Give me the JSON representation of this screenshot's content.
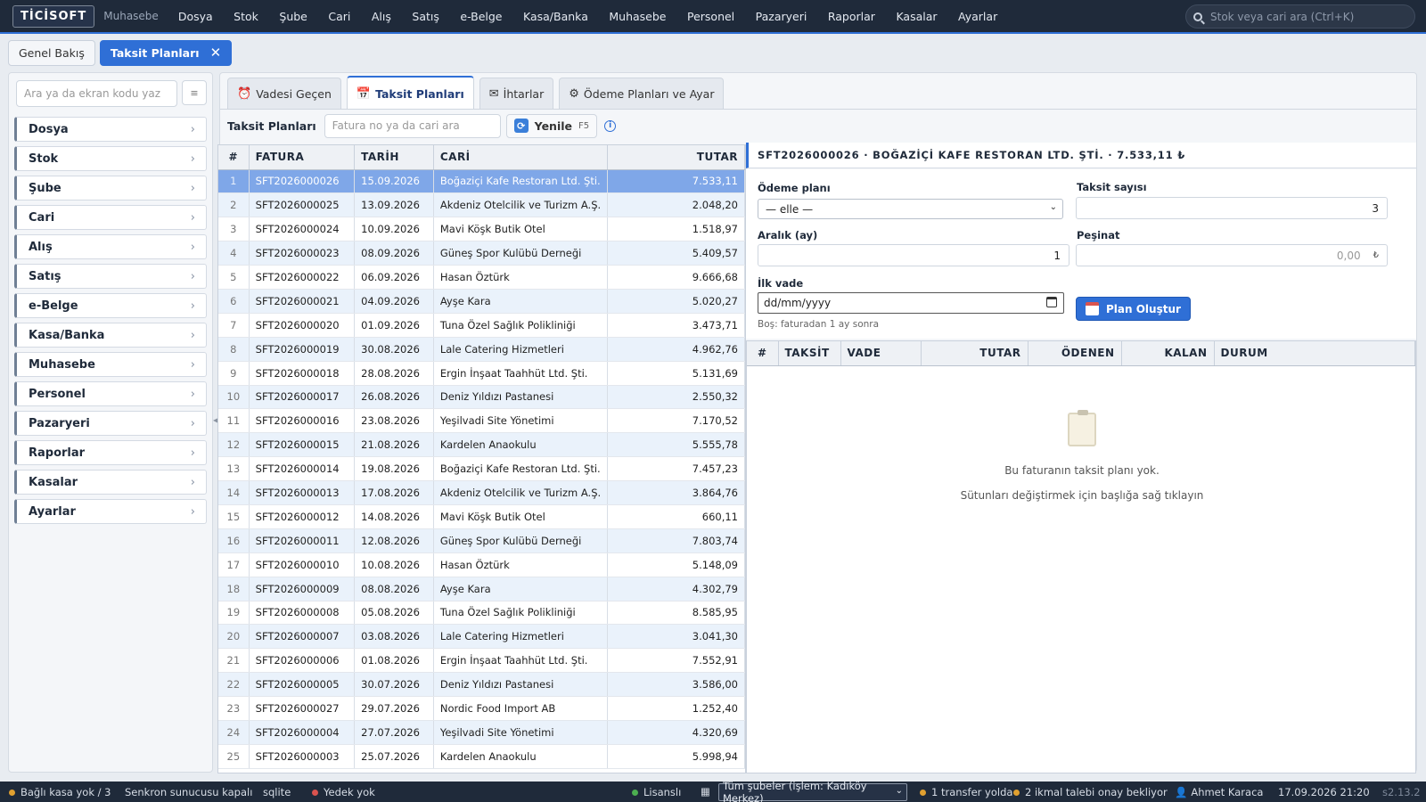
{
  "app": {
    "logo": "TİCİSOFT",
    "subtitle": "Muhasebe"
  },
  "top_menu": [
    "Dosya",
    "Stok",
    "Şube",
    "Cari",
    "Alış",
    "Satış",
    "e-Belge",
    "Kasa/Banka",
    "Muhasebe",
    "Personel",
    "Pazaryeri",
    "Raporlar",
    "Kasalar",
    "Ayarlar"
  ],
  "top_search": {
    "placeholder": "Stok veya cari ara (Ctrl+K)"
  },
  "page_tabs": [
    {
      "label": "Genel Bakış",
      "active": false
    },
    {
      "label": "Taksit Planları",
      "active": true,
      "close": "✕"
    }
  ],
  "sidebar": {
    "search_placeholder": "Ara ya da ekran kodu yaz",
    "button_icon": "≡",
    "items": [
      "Dosya",
      "Stok",
      "Şube",
      "Cari",
      "Alış",
      "Satış",
      "e-Belge",
      "Kasa/Banka",
      "Muhasebe",
      "Personel",
      "Pazaryeri",
      "Raporlar",
      "Kasalar",
      "Ayarlar"
    ],
    "chevron": "›"
  },
  "content_tabs": [
    {
      "label": "Vadesi Geçen",
      "icon": "⏰",
      "icon_name": "alarm-clock-icon"
    },
    {
      "label": "Taksit Planları",
      "icon": "📅",
      "icon_name": "calendar-icon"
    },
    {
      "label": "İhtarlar",
      "icon": "✉",
      "icon_name": "envelope-icon"
    },
    {
      "label": "Ödeme Planları ve Ayar",
      "icon": "⚙",
      "icon_name": "gear-icon"
    }
  ],
  "toolbar": {
    "label": "Taksit Planları",
    "search_placeholder": "Fatura no ya da cari ara",
    "refresh_label": "Yenile",
    "refresh_key": "F5",
    "info": "i"
  },
  "invoice_grid": {
    "columns": [
      "#",
      "FATURA",
      "TARİH",
      "CARİ",
      "TUTAR"
    ],
    "selected_index": 0,
    "rows": [
      [
        "1",
        "SFT2026000026",
        "15.09.2026",
        "Boğaziçi Kafe Restoran Ltd. Şti.",
        "7.533,11"
      ],
      [
        "2",
        "SFT2026000025",
        "13.09.2026",
        "Akdeniz Otelcilik ve Turizm A.Ş.",
        "2.048,20"
      ],
      [
        "3",
        "SFT2026000024",
        "10.09.2026",
        "Mavi Köşk Butik Otel",
        "1.518,97"
      ],
      [
        "4",
        "SFT2026000023",
        "08.09.2026",
        "Güneş Spor Kulübü Derneği",
        "5.409,57"
      ],
      [
        "5",
        "SFT2026000022",
        "06.09.2026",
        "Hasan Öztürk",
        "9.666,68"
      ],
      [
        "6",
        "SFT2026000021",
        "04.09.2026",
        "Ayşe Kara",
        "5.020,27"
      ],
      [
        "7",
        "SFT2026000020",
        "01.09.2026",
        "Tuna Özel Sağlık Polikliniği",
        "3.473,71"
      ],
      [
        "8",
        "SFT2026000019",
        "30.08.2026",
        "Lale Catering Hizmetleri",
        "4.962,76"
      ],
      [
        "9",
        "SFT2026000018",
        "28.08.2026",
        "Ergin İnşaat Taahhüt Ltd. Şti.",
        "5.131,69"
      ],
      [
        "10",
        "SFT2026000017",
        "26.08.2026",
        "Deniz Yıldızı Pastanesi",
        "2.550,32"
      ],
      [
        "11",
        "SFT2026000016",
        "23.08.2026",
        "Yeşilvadi Site Yönetimi",
        "7.170,52"
      ],
      [
        "12",
        "SFT2026000015",
        "21.08.2026",
        "Kardelen Anaokulu",
        "5.555,78"
      ],
      [
        "13",
        "SFT2026000014",
        "19.08.2026",
        "Boğaziçi Kafe Restoran Ltd. Şti.",
        "7.457,23"
      ],
      [
        "14",
        "SFT2026000013",
        "17.08.2026",
        "Akdeniz Otelcilik ve Turizm A.Ş.",
        "3.864,76"
      ],
      [
        "15",
        "SFT2026000012",
        "14.08.2026",
        "Mavi Köşk Butik Otel",
        "660,11"
      ],
      [
        "16",
        "SFT2026000011",
        "12.08.2026",
        "Güneş Spor Kulübü Derneği",
        "7.803,74"
      ],
      [
        "17",
        "SFT2026000010",
        "10.08.2026",
        "Hasan Öztürk",
        "5.148,09"
      ],
      [
        "18",
        "SFT2026000009",
        "08.08.2026",
        "Ayşe Kara",
        "4.302,79"
      ],
      [
        "19",
        "SFT2026000008",
        "05.08.2026",
        "Tuna Özel Sağlık Polikliniği",
        "8.585,95"
      ],
      [
        "20",
        "SFT2026000007",
        "03.08.2026",
        "Lale Catering Hizmetleri",
        "3.041,30"
      ],
      [
        "21",
        "SFT2026000006",
        "01.08.2026",
        "Ergin İnşaat Taahhüt Ltd. Şti.",
        "7.552,91"
      ],
      [
        "22",
        "SFT2026000005",
        "30.07.2026",
        "Deniz Yıldızı Pastanesi",
        "3.586,00"
      ],
      [
        "23",
        "SFT2026000027",
        "29.07.2026",
        "Nordic Food Import AB",
        "1.252,40"
      ],
      [
        "24",
        "SFT2026000004",
        "27.07.2026",
        "Yeşilvadi Site Yönetimi",
        "4.320,69"
      ],
      [
        "25",
        "SFT2026000003",
        "25.07.2026",
        "Kardelen Anaokulu",
        "5.998,94"
      ]
    ]
  },
  "detail": {
    "header": "SFT2026000026 · BOĞAZİÇİ KAFE RESTORAN LTD. ŞTİ. · 7.533,11 ₺",
    "payment_plan_label": "Ödeme planı",
    "payment_plan_value": "— elle —",
    "installment_count_label": "Taksit sayısı",
    "installment_count_value": "3",
    "interval_label": "Aralık (ay)",
    "interval_value": "1",
    "down_payment_label": "Peşinat",
    "down_payment_value": "0,00",
    "currency": "₺",
    "first_due_label": "İlk vade",
    "first_due_placeholder": "dd/mm/yyyy",
    "first_due_hint": "Boş: faturadan 1 ay sonra",
    "create_button": "Plan Oluştur"
  },
  "schedule_grid": {
    "columns": [
      "#",
      "TAKSİT",
      "VADE",
      "TUTAR",
      "ÖDENEN",
      "KALAN",
      "DURUM"
    ],
    "empty_text": "Bu faturanın taksit planı yok.",
    "hint_text": "Sütunları değiştirmek için başlığa sağ tıklayın"
  },
  "statusbar": {
    "kasa": "Bağlı kasa yok / 3",
    "sync": "Senkron sunucusu kapalı",
    "db": "sqlite",
    "backup": "Yedek yok",
    "license": "Lisanslı",
    "branch_select": "Tüm şubeler (işlem: Kadıköy Merkez)",
    "transfer": "1 transfer yolda",
    "supply": "2 ikmal talebi onay bekliyor",
    "user": "Ahmet Karaca",
    "datetime": "17.09.2026 21:20",
    "version": "s2.13.2"
  },
  "colors": {
    "accent": "#2f6fd6",
    "topbar": "#1f2a3a",
    "selected_row": "#7fa7e8",
    "warn_dot": "#e0a030",
    "err_dot": "#d9534f",
    "ok_dot": "#4caf50"
  }
}
